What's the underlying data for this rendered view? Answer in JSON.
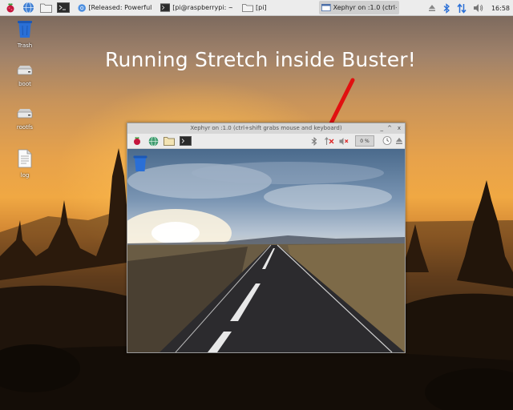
{
  "taskbar": {
    "tasks": [
      {
        "label": "[Released: Powerful T...",
        "icon": "chromium-icon"
      },
      {
        "label": "[pi@raspberrypi: ~]",
        "icon": "terminal-icon"
      },
      {
        "label": "[pi]",
        "icon": "folder-icon"
      },
      {
        "label": "Xephyr on :1.0 (ctrl+s...",
        "icon": "window-icon"
      }
    ],
    "clock": "16:58"
  },
  "desktop": {
    "icons": [
      {
        "label": "Trash",
        "icon": "trash-icon"
      },
      {
        "label": "boot",
        "icon": "drive-icon"
      },
      {
        "label": "rootfs",
        "icon": "drive-icon"
      },
      {
        "label": "log",
        "icon": "document-icon"
      }
    ]
  },
  "overlay": {
    "headline": "Running Stretch inside Buster!"
  },
  "xephyr": {
    "title": "Xephyr on :1.0 (ctrl+shift grabs mouse and keyboard)",
    "cpu_label": "0 %",
    "buttons": {
      "minimize": "_",
      "maximize": "^",
      "close": "x"
    }
  },
  "colors": {
    "taskbar_bg": "#ececec",
    "arrow": "#e11010",
    "headline": "#ffffff",
    "trash_blue": "#2a6fd6"
  }
}
